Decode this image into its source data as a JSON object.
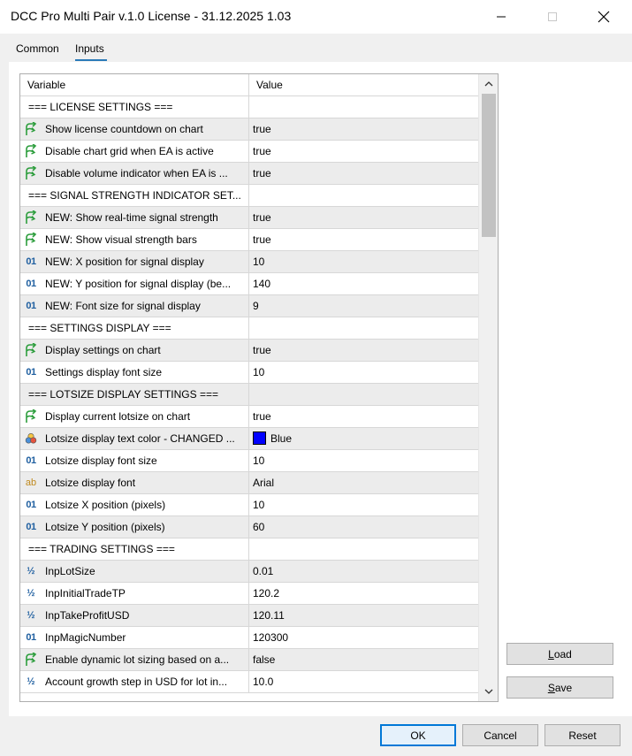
{
  "window": {
    "title": "DCC Pro Multi Pair v.1.0 License - 31.12.2025 1.03"
  },
  "tabs": [
    {
      "label": "Common",
      "active": false
    },
    {
      "label": "Inputs",
      "active": true
    }
  ],
  "grid": {
    "columns": [
      "Variable",
      "Value"
    ],
    "rows": [
      {
        "icon": "none",
        "variable": "=== LICENSE SETTINGS ===",
        "value": ""
      },
      {
        "icon": "bool-icon",
        "variable": "Show license countdown on chart",
        "value": "true"
      },
      {
        "icon": "bool-icon",
        "variable": "Disable chart grid when EA is active",
        "value": "true"
      },
      {
        "icon": "bool-icon",
        "variable": "Disable volume indicator when EA is ...",
        "value": "true"
      },
      {
        "icon": "none",
        "variable": "=== SIGNAL STRENGTH INDICATOR SET...",
        "value": ""
      },
      {
        "icon": "bool-icon",
        "variable": "NEW: Show real-time signal strength",
        "value": "true"
      },
      {
        "icon": "bool-icon",
        "variable": "NEW: Show visual strength bars",
        "value": "true"
      },
      {
        "icon": "int-icon",
        "variable": "NEW: X position for signal display",
        "value": "10"
      },
      {
        "icon": "int-icon",
        "variable": "NEW: Y position for signal display (be...",
        "value": "140"
      },
      {
        "icon": "int-icon",
        "variable": "NEW: Font size for signal display",
        "value": "9"
      },
      {
        "icon": "none",
        "variable": "=== SETTINGS DISPLAY ===",
        "value": ""
      },
      {
        "icon": "bool-icon",
        "variable": "Display settings on chart",
        "value": "true"
      },
      {
        "icon": "int-icon",
        "variable": "Settings display font size",
        "value": "10"
      },
      {
        "icon": "none",
        "variable": "=== LOTSIZE DISPLAY SETTINGS ===",
        "value": ""
      },
      {
        "icon": "bool-icon",
        "variable": "Display current lotsize on chart",
        "value": "true"
      },
      {
        "icon": "color-icon",
        "variable": "Lotsize display text color - CHANGED ...",
        "value": "Blue",
        "swatch": "#0000ff"
      },
      {
        "icon": "int-icon",
        "variable": "Lotsize display font size",
        "value": "10"
      },
      {
        "icon": "string-icon",
        "variable": "Lotsize display font",
        "value": "Arial"
      },
      {
        "icon": "int-icon",
        "variable": "Lotsize X position (pixels)",
        "value": "10"
      },
      {
        "icon": "int-icon",
        "variable": "Lotsize Y position (pixels)",
        "value": "60"
      },
      {
        "icon": "none",
        "variable": "=== TRADING SETTINGS ===",
        "value": ""
      },
      {
        "icon": "double-icon",
        "variable": "InpLotSize",
        "value": "0.01"
      },
      {
        "icon": "double-icon",
        "variable": "InpInitialTradeTP",
        "value": "120.2"
      },
      {
        "icon": "double-icon",
        "variable": "InpTakeProfitUSD",
        "value": "120.11"
      },
      {
        "icon": "int-icon",
        "variable": "InpMagicNumber",
        "value": "120300"
      },
      {
        "icon": "bool-icon",
        "variable": "Enable dynamic lot sizing based on a...",
        "value": "false"
      },
      {
        "icon": "double-icon",
        "variable": "Account growth step in USD for lot in...",
        "value": "10.0"
      }
    ]
  },
  "icon_glyphs": {
    "int-icon": "01",
    "string-icon": "ab",
    "double-icon": "½"
  },
  "buttons": {
    "load_prefix": "",
    "load_ul": "L",
    "load_rest": "oad",
    "save_ul": "S",
    "save_rest": "ave",
    "ok": "OK",
    "cancel": "Cancel",
    "reset": "Reset"
  },
  "colors": {
    "accent": "#0078d7",
    "bool_icon": "#2e9e3e",
    "int_icon": "#1f5fa0",
    "string_icon": "#c08a1e"
  }
}
